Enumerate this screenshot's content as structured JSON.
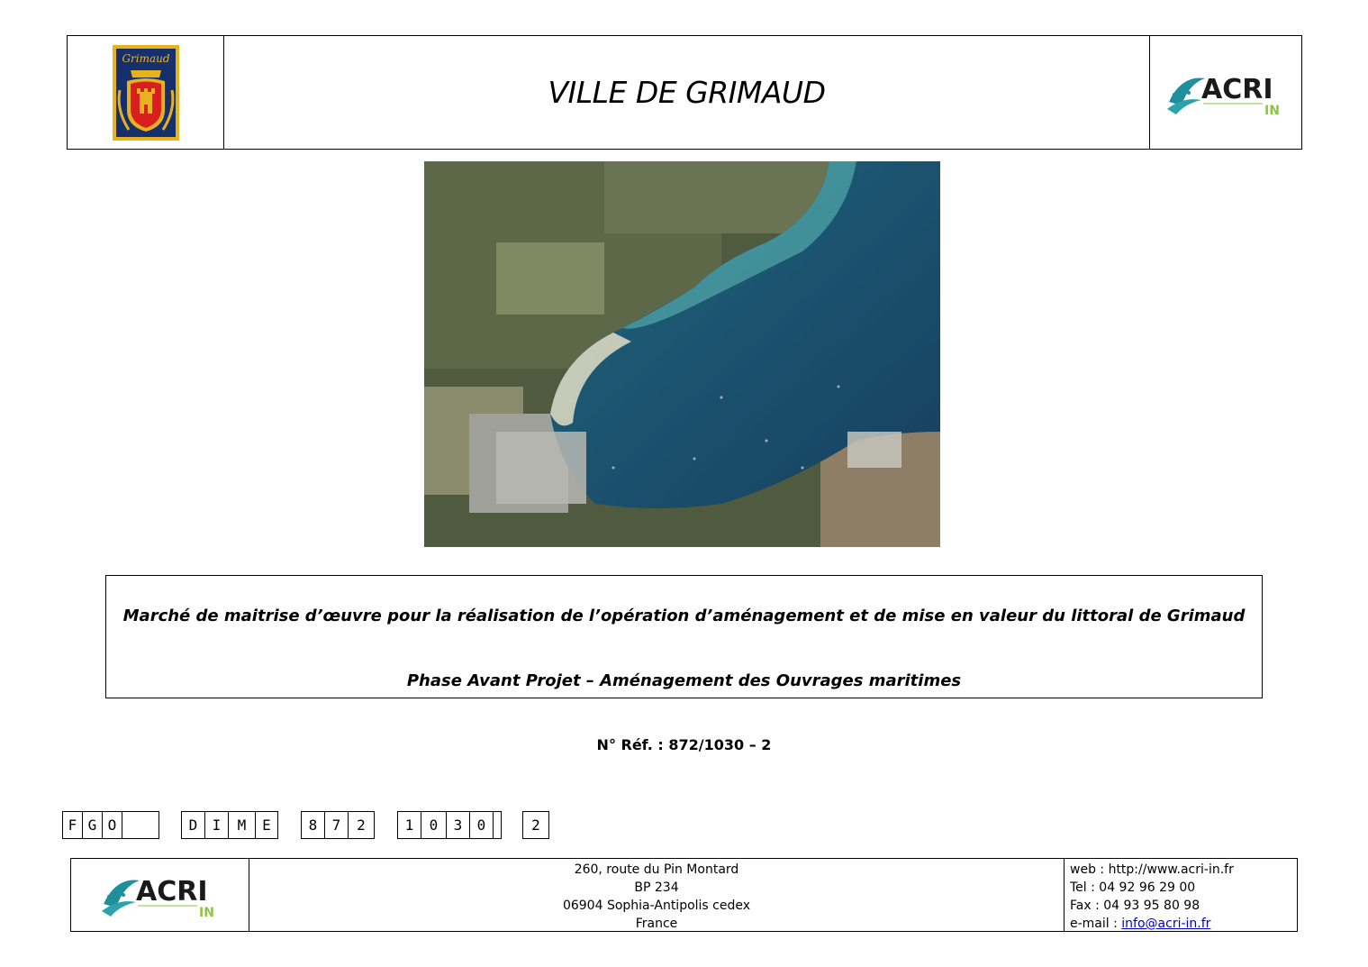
{
  "header": {
    "title": "VILLE DE GRIMAUD",
    "crest_text": "Grimaud",
    "acri_logo": {
      "name": "ACRI",
      "sub": "IN"
    }
  },
  "subject": {
    "line1": "Marché de maitrise d’œuvre pour la réalisation de l’opération d’aménagement et de mise en valeur du littoral de Grimaud",
    "line2": "Phase Avant Projet –  Aménagement des Ouvrages maritimes"
  },
  "reference": "N° Réf. : 872/1030 – 2",
  "code_groups": [
    [
      "F",
      "G",
      "O",
      ""
    ],
    [
      "D",
      "I",
      "M",
      "E"
    ],
    [
      "8",
      "7",
      "2"
    ],
    [
      "1",
      "0",
      "3",
      "0",
      ""
    ],
    [
      "2"
    ]
  ],
  "footer": {
    "address": [
      "260, route du Pin Montard",
      "BP 234",
      "06904 Sophia-Antipolis cedex",
      "France"
    ],
    "web": "web : http://www.acri-in.fr",
    "tel": "Tel : 04 92 96 29 00",
    "fax": "Fax : 04 93 95 80 98",
    "email_label": "e-mail : ",
    "email": "info@acri-in.fr"
  },
  "colors": {
    "crest_blue": "#16306e",
    "crest_gold": "#e8b21e",
    "acri_teal": "#1f8f9b",
    "acri_green": "#8cc63f"
  }
}
